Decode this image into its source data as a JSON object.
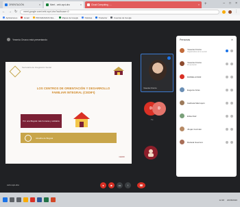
{
  "browser": {
    "tabs": [
      {
        "label": "ORIENTACIÓN",
        "color": "#1a73e8"
      },
      {
        "label": "Meet - cebi-xqxt-dno",
        "color": "#188038"
      },
      {
        "label": "Cloud Computing - ...",
        "color": "#ffffff"
      }
    ],
    "url": "meet.google.com/cebi-xqxt-dno?authuser=0",
    "bookmarks": [
      {
        "label": "Aplicaciones",
        "color": "#4285f4"
      },
      {
        "label": "Gmail",
        "color": "#d93025"
      },
      {
        "label": "PROGRAMAS DEL...",
        "color": "#f9ab00"
      },
      {
        "label": "Mapas de Google",
        "color": "#188038"
      },
      {
        "label": "Noticias",
        "color": "#4285f4"
      },
      {
        "label": "Traductor",
        "color": "#1a73e8"
      },
      {
        "label": "Cuentas de Google",
        "color": "#5f6368"
      }
    ]
  },
  "meeting": {
    "presenter_label": "Yesenia Orozco está presentando",
    "slide": {
      "brand_text": "Secretaría de Integración Social",
      "headline": "LOS CENTROS DE ORIENTACIÓN Y DESARROLLO FAMILIAR INTEGRAL (CEDIFI)",
      "box_text": "Por una Bogotá más humana y solidaria",
      "band_text": "Alcaldía de Bogotá",
      "footer": "CEDIFI"
    },
    "main_tile_name": "Yesenia Orozco",
    "participant_initial_a": "D",
    "participant_initial_b": "D",
    "participant_label_a": "Tú",
    "meeting_code": "cebi-xqxt-dno"
  },
  "panel": {
    "title": "Personas",
    "close": "✕",
    "people": [
      {
        "name": "Yesenia Orozco",
        "sub": "Organizadora de la reunión",
        "color": "#c26b3a",
        "active": true
      },
      {
        "name": "Yesenia Orozco",
        "sub": "Presentación",
        "color": "#8d4b2f",
        "active": false
      },
      {
        "name": "DANIELA DIAZ",
        "sub": "",
        "color": "#d93025",
        "active": false
      },
      {
        "name": "Eugenio Arias",
        "sub": "",
        "color": "#6b8fb5",
        "active": false
      },
      {
        "name": "Gabriela Marroquín",
        "sub": "",
        "color": "#9c7a5b",
        "active": false
      },
      {
        "name": "Erika Ruiz",
        "sub": "",
        "color": "#7aa07a",
        "active": false
      },
      {
        "name": "Jhojan Guzmán",
        "sub": "",
        "color": "#b78a65",
        "active": false
      },
      {
        "name": "Daniela Guerrero",
        "sub": "",
        "color": "#a86e58",
        "active": false
      }
    ]
  },
  "taskbar": {
    "clock": "12:48",
    "date": "20/08/2020"
  }
}
